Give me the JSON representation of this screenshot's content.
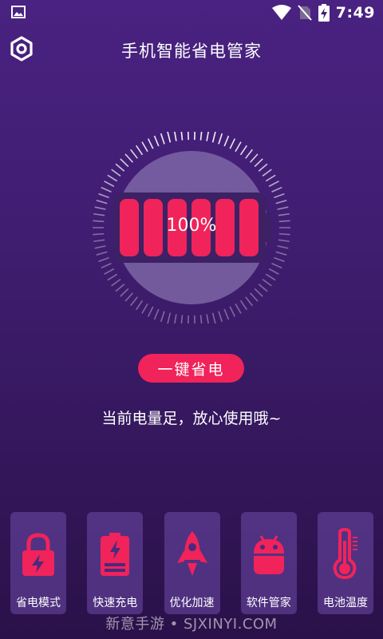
{
  "status_bar": {
    "time": "7:49",
    "icons": [
      "image-icon",
      "wifi-icon",
      "no-sim-icon",
      "battery-charging-icon"
    ]
  },
  "app_bar": {
    "title": "手机智能省电管家",
    "settings_icon": "hexagon-settings-icon"
  },
  "battery": {
    "percent_label": "100%",
    "level": 1.0,
    "bar_color": "#f0235b"
  },
  "actions": {
    "save_button": "一键省电",
    "status_message": "当前电量足，放心使用哦~"
  },
  "tiles": [
    {
      "label": "省电模式",
      "icon": "lock-bolt-icon"
    },
    {
      "label": "快速充电",
      "icon": "battery-bolt-icon"
    },
    {
      "label": "优化加速",
      "icon": "rocket-icon"
    },
    {
      "label": "软件管家",
      "icon": "android-icon"
    },
    {
      "label": "电池温度",
      "icon": "thermometer-icon"
    }
  ],
  "watermark": "新意手游 • SJXINYI.COM",
  "colors": {
    "accent": "#f0235b",
    "background_top": "#4a2282",
    "background_bottom": "#2a1149"
  }
}
